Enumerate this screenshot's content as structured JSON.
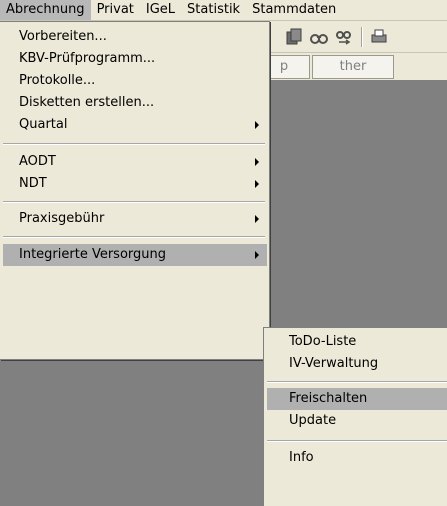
{
  "menubar": {
    "items": [
      "Abrechnung",
      "Privat",
      "IGeL",
      "Statistik",
      "Stammdaten"
    ]
  },
  "tabs": [
    "p",
    "ther"
  ],
  "menu": {
    "items": [
      {
        "label": "Vorbereiten..."
      },
      {
        "label": "KBV-Prüfprogramm..."
      },
      {
        "label": "Protokolle..."
      },
      {
        "label": "Disketten erstellen..."
      },
      {
        "label": "Quartal"
      },
      {
        "label": "AODT"
      },
      {
        "label": "NDT"
      },
      {
        "label": "Praxisgebühr"
      },
      {
        "label": "Integrierte Versorgung"
      }
    ]
  },
  "submenu": {
    "items": [
      {
        "label": "ToDo-Liste"
      },
      {
        "label": "IV-Verwaltung"
      },
      {
        "label": "Freischalten"
      },
      {
        "label": "Update"
      },
      {
        "label": "Info"
      }
    ]
  },
  "colors": {
    "highlight": "#b0b0b0",
    "background": "#ece9d8",
    "workspace": "#808080"
  },
  "icons": [
    "copy-icon",
    "find-icon",
    "find-next-icon",
    "print-icon"
  ]
}
